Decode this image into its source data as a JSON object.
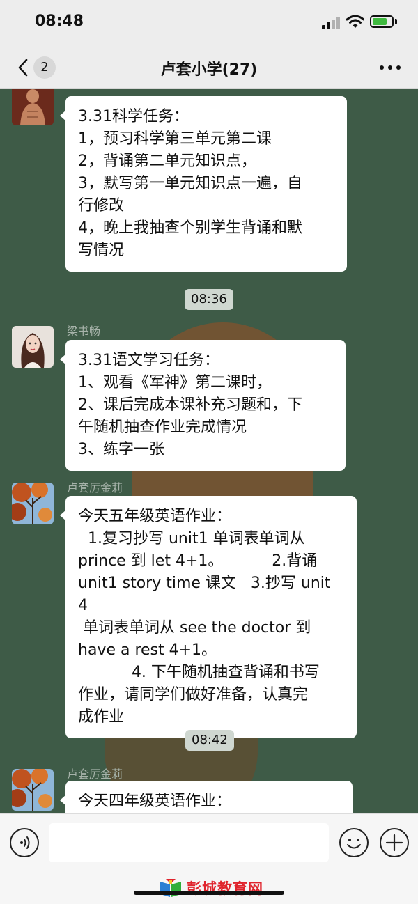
{
  "status": {
    "time": "08:48"
  },
  "nav": {
    "unread_count": "2",
    "title": "卢套小学(27)"
  },
  "messages": [
    {
      "sender": "",
      "text": "3.31科学任务：\n1，预习科学第三单元第二课\n2，背诵第二单元知识点，\n3，默写第一单元知识点一遍，自\n行修改\n4，晚上我抽查个别学生背诵和默\n写情况"
    },
    {
      "sender": "梁书畅",
      "text": "3.31语文学习任务：\n1、观看《军神》第二课时，\n2、课后完成本课补充习题和，下\n午随机抽查作业完成情况\n3、练字一张"
    },
    {
      "sender": "卢套厉金莉",
      "text": "今天五年级英语作业：\n  1.复习抄写 unit1 单词表单词从\nprince 到 let 4+1。          2.背诵\nunit1 story time 课文   3.抄写 unit 4\n 单词表单词从 see the doctor 到\nhave a rest 4+1。\n           4. 下午随机抽查背诵和书写\n作业，请同学们做好准备，认真完\n成作业"
    },
    {
      "sender": "卢套厉金莉",
      "text": "今天四年级英语作业："
    }
  ],
  "timestamps": [
    "08:36",
    "08:42"
  ],
  "input": {
    "placeholder": ""
  },
  "watermark": {
    "text": "彭城教育网"
  },
  "colors": {
    "chat_bg": "#3e5b47",
    "bubble": "#ffffff",
    "timestamp_bg": "#cfd7d0",
    "watermark": "#e0242d"
  },
  "icons": [
    "back-chevron-icon",
    "more-dots-icon",
    "voice-icon",
    "emoji-icon",
    "plus-icon",
    "signal-icon",
    "wifi-icon",
    "battery-icon"
  ]
}
